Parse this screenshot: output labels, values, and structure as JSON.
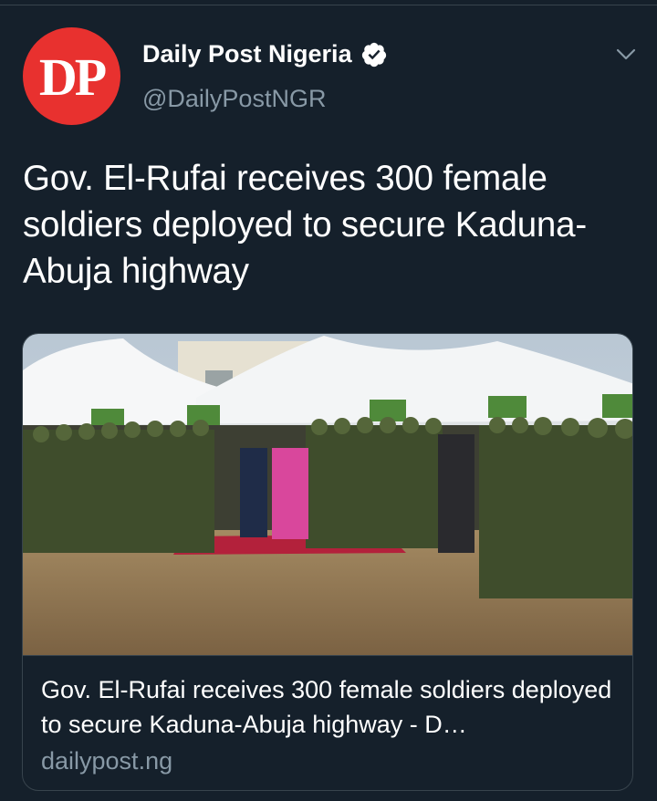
{
  "tweet": {
    "avatar_text": "DP",
    "display_name": "Daily Post Nigeria",
    "handle": "@DailyPostNGR",
    "verified": true,
    "text": "Gov. El-Rufai receives 300 female soldiers deployed to secure Kaduna-Abuja highway"
  },
  "card": {
    "title": "Gov. El-Rufai receives 300 female soldiers deployed to secure Kaduna-Abuja highway - D…",
    "domain": "dailypost.ng"
  },
  "icons": {
    "verified": "verified-badge-icon",
    "menu": "chevron-down-icon"
  },
  "colors": {
    "background": "#15202b",
    "avatar": "#e8312f",
    "secondary_text": "#8899a6",
    "border": "#38444d"
  }
}
